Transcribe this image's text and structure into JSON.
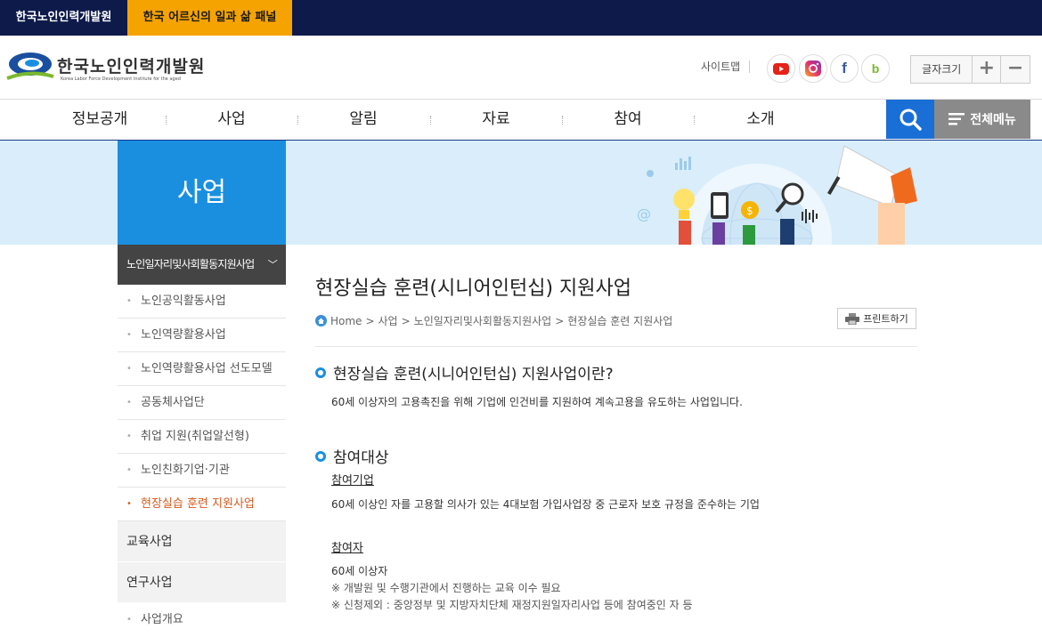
{
  "topbar": {
    "site1": "한국노인인력개발원",
    "site2": "한국 어르신의 일과 삶 패널"
  },
  "header": {
    "logo_name": "한국노인인력개발원",
    "logo_sub": "Korea Labor Force Development Institute for the aged",
    "sitemap": "사이트맵",
    "sns": [
      "youtube-icon",
      "instagram-icon",
      "facebook-icon",
      "blog-icon"
    ],
    "fontsize_label": "글자크기",
    "plus": "+",
    "minus": "−"
  },
  "gnb": {
    "items": [
      "정보공개",
      "사업",
      "알림",
      "자료",
      "참여",
      "소개"
    ],
    "allmenu": "전체메뉴"
  },
  "banner": {
    "title": "사업"
  },
  "lnb": {
    "head": "노인일자리및사회활동지원사업",
    "subs": [
      "노인공익활동사업",
      "노인역량활용사업",
      "노인역량활용사업 선도모델",
      "공동체사업단",
      "취업 지원(취업알선형)",
      "노인친화기업·기관",
      "현장실습 훈련 지원사업"
    ],
    "cat1": "교육사업",
    "cat2": "연구사업",
    "sub_last": "사업개요"
  },
  "content": {
    "title": "현장실습 훈련(시니어인턴십) 지원사업",
    "breadcrumb": [
      "Home",
      "사업",
      "노인일자리및사회활동지원사업",
      "현장실습 훈련 지원사업"
    ],
    "breadcrumb_sep": ">",
    "print": "프린트하기",
    "sec1_title": "현장실습 훈련(시니어인턴십) 지원사업이란?",
    "sec1_text": "60세 이상자의 고용촉진을 위해 기업에 인건비를 지원하여 계속고용을 유도하는 사업입니다.",
    "sec2_title": "참여대상",
    "sub1_label": "참여기업",
    "sub1_text": "60세 이상인 자를 고용할 의사가 있는 4대보험 가입사업장 중 근로자 보호 규정을 준수하는 기업",
    "sub2_label": "참여자",
    "sub2_text": "60세 이상자",
    "note1": "※ 개발원 및 수행기관에서 진행하는 교육 이수 필요",
    "note2": "※ 신청제외 : 중앙정부 및 지방자치단체 재정지원일자리사업 등에 참여중인 자 등"
  },
  "colors": {
    "navy": "#0d1a4a",
    "orange": "#f5a300",
    "blue": "#1a8fe0",
    "active": "#d45a1e"
  }
}
